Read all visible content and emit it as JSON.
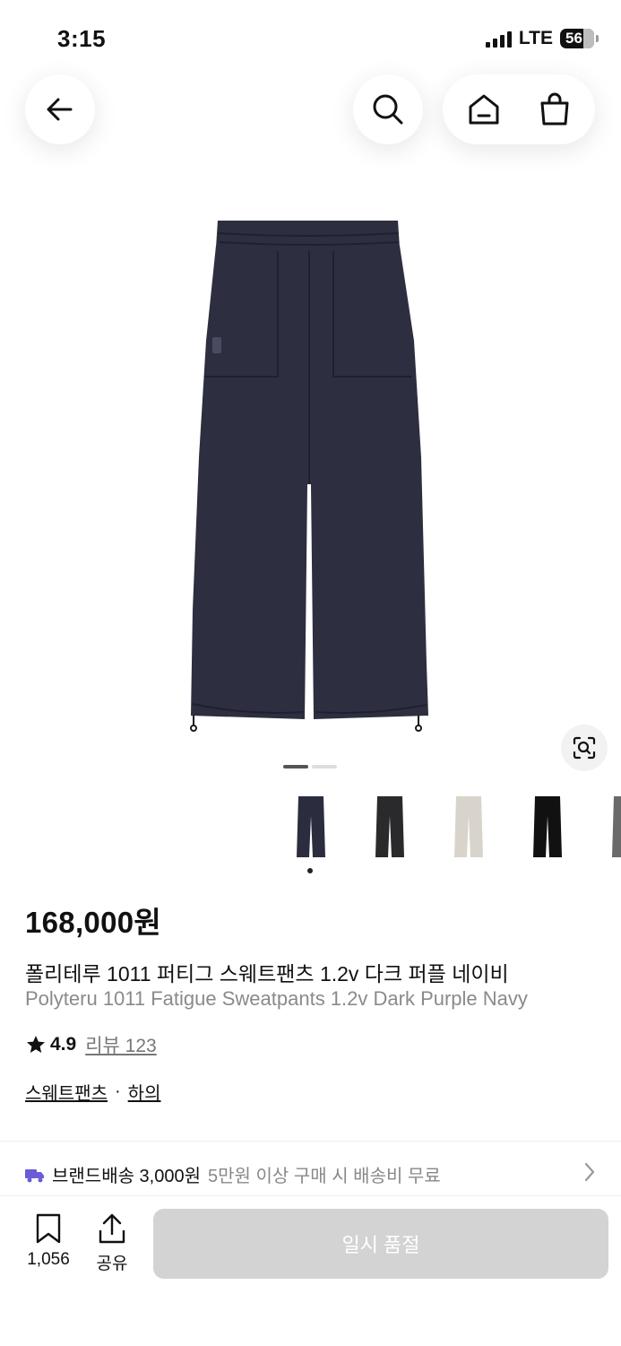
{
  "status": {
    "time": "3:15",
    "network": "LTE",
    "battery": "56"
  },
  "icons": {
    "back": "back-arrow-icon",
    "search": "search-icon",
    "home": "home-icon",
    "bag": "shopping-bag-icon",
    "camera": "lens-search-icon",
    "truck": "truck-icon",
    "chevron": "chevron-right-icon",
    "bookmark": "bookmark-icon",
    "share": "share-icon",
    "star": "star-icon"
  },
  "product": {
    "price": "168,000원",
    "title_ko": "폴리테루 1011 퍼티그 스웨트팬츠 1.2v 다크 퍼플 네이비",
    "title_en": "Polyteru 1011 Fatigue Sweatpants 1.2v Dark Purple Navy",
    "rating": "4.9",
    "review_label": "리뷰 123",
    "category": "스웨트팬츠",
    "separator": "·",
    "category_parent": "하의",
    "image_count": 2,
    "current_image": 1
  },
  "thumbnails": [
    {
      "color": "#2b2d3f",
      "selected": true
    },
    {
      "color": "#2a2a2c",
      "selected": false
    },
    {
      "color": "#d9d4cb",
      "selected": false
    },
    {
      "color": "#111111",
      "selected": false
    },
    {
      "color": "#6a6a6a",
      "selected": false
    }
  ],
  "shipping": {
    "label": "브랜드배송 3,000원",
    "note": "5만원 이상 구매 시 배송비 무료",
    "truck_color": "#6b5bd6"
  },
  "bottom": {
    "bookmark_count": "1,056",
    "share_label": "공유",
    "button_label": "일시 품절"
  },
  "colors": {
    "disabled_button": "#d3d3d3",
    "muted_text": "#8a8a8a"
  }
}
